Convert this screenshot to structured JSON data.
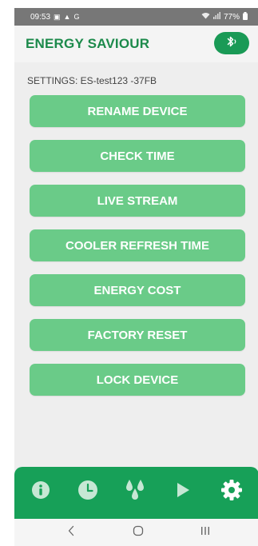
{
  "status_bar": {
    "time": "09:53",
    "battery": "77%"
  },
  "header": {
    "title": "ENERGY SAVIOUR",
    "bluetooth_icon": "bluetooth-icon"
  },
  "settings_label": "SETTINGS: ES-test123   -37FB",
  "menu": [
    {
      "label": "RENAME DEVICE"
    },
    {
      "label": "CHECK TIME"
    },
    {
      "label": "LIVE STREAM"
    },
    {
      "label": "COOLER REFRESH TIME"
    },
    {
      "label": "ENERGY COST"
    },
    {
      "label": "FACTORY RESET"
    },
    {
      "label": "LOCK DEVICE"
    }
  ],
  "bottom_nav": {
    "items": [
      "info-icon",
      "clock-icon",
      "drops-icon",
      "play-icon",
      "gear-icon"
    ],
    "active": "gear-icon"
  },
  "colors": {
    "brand_green": "#17a058",
    "button_green": "#6acb88",
    "title_green": "#1c8a4b"
  }
}
